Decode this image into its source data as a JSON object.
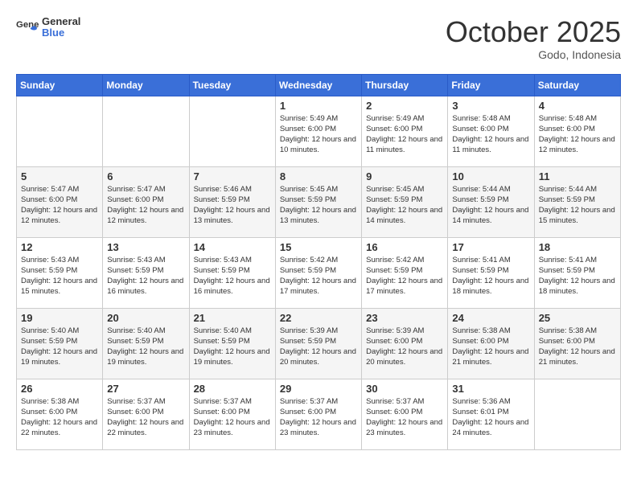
{
  "header": {
    "logo_general": "General",
    "logo_blue": "Blue",
    "month": "October 2025",
    "location": "Godo, Indonesia"
  },
  "weekdays": [
    "Sunday",
    "Monday",
    "Tuesday",
    "Wednesday",
    "Thursday",
    "Friday",
    "Saturday"
  ],
  "weeks": [
    [
      {
        "day": "",
        "text": ""
      },
      {
        "day": "",
        "text": ""
      },
      {
        "day": "",
        "text": ""
      },
      {
        "day": "1",
        "text": "Sunrise: 5:49 AM\nSunset: 6:00 PM\nDaylight: 12 hours and 10 minutes."
      },
      {
        "day": "2",
        "text": "Sunrise: 5:49 AM\nSunset: 6:00 PM\nDaylight: 12 hours and 11 minutes."
      },
      {
        "day": "3",
        "text": "Sunrise: 5:48 AM\nSunset: 6:00 PM\nDaylight: 12 hours and 11 minutes."
      },
      {
        "day": "4",
        "text": "Sunrise: 5:48 AM\nSunset: 6:00 PM\nDaylight: 12 hours and 12 minutes."
      }
    ],
    [
      {
        "day": "5",
        "text": "Sunrise: 5:47 AM\nSunset: 6:00 PM\nDaylight: 12 hours and 12 minutes."
      },
      {
        "day": "6",
        "text": "Sunrise: 5:47 AM\nSunset: 6:00 PM\nDaylight: 12 hours and 12 minutes."
      },
      {
        "day": "7",
        "text": "Sunrise: 5:46 AM\nSunset: 5:59 PM\nDaylight: 12 hours and 13 minutes."
      },
      {
        "day": "8",
        "text": "Sunrise: 5:45 AM\nSunset: 5:59 PM\nDaylight: 12 hours and 13 minutes."
      },
      {
        "day": "9",
        "text": "Sunrise: 5:45 AM\nSunset: 5:59 PM\nDaylight: 12 hours and 14 minutes."
      },
      {
        "day": "10",
        "text": "Sunrise: 5:44 AM\nSunset: 5:59 PM\nDaylight: 12 hours and 14 minutes."
      },
      {
        "day": "11",
        "text": "Sunrise: 5:44 AM\nSunset: 5:59 PM\nDaylight: 12 hours and 15 minutes."
      }
    ],
    [
      {
        "day": "12",
        "text": "Sunrise: 5:43 AM\nSunset: 5:59 PM\nDaylight: 12 hours and 15 minutes."
      },
      {
        "day": "13",
        "text": "Sunrise: 5:43 AM\nSunset: 5:59 PM\nDaylight: 12 hours and 16 minutes."
      },
      {
        "day": "14",
        "text": "Sunrise: 5:43 AM\nSunset: 5:59 PM\nDaylight: 12 hours and 16 minutes."
      },
      {
        "day": "15",
        "text": "Sunrise: 5:42 AM\nSunset: 5:59 PM\nDaylight: 12 hours and 17 minutes."
      },
      {
        "day": "16",
        "text": "Sunrise: 5:42 AM\nSunset: 5:59 PM\nDaylight: 12 hours and 17 minutes."
      },
      {
        "day": "17",
        "text": "Sunrise: 5:41 AM\nSunset: 5:59 PM\nDaylight: 12 hours and 18 minutes."
      },
      {
        "day": "18",
        "text": "Sunrise: 5:41 AM\nSunset: 5:59 PM\nDaylight: 12 hours and 18 minutes."
      }
    ],
    [
      {
        "day": "19",
        "text": "Sunrise: 5:40 AM\nSunset: 5:59 PM\nDaylight: 12 hours and 19 minutes."
      },
      {
        "day": "20",
        "text": "Sunrise: 5:40 AM\nSunset: 5:59 PM\nDaylight: 12 hours and 19 minutes."
      },
      {
        "day": "21",
        "text": "Sunrise: 5:40 AM\nSunset: 5:59 PM\nDaylight: 12 hours and 19 minutes."
      },
      {
        "day": "22",
        "text": "Sunrise: 5:39 AM\nSunset: 5:59 PM\nDaylight: 12 hours and 20 minutes."
      },
      {
        "day": "23",
        "text": "Sunrise: 5:39 AM\nSunset: 6:00 PM\nDaylight: 12 hours and 20 minutes."
      },
      {
        "day": "24",
        "text": "Sunrise: 5:38 AM\nSunset: 6:00 PM\nDaylight: 12 hours and 21 minutes."
      },
      {
        "day": "25",
        "text": "Sunrise: 5:38 AM\nSunset: 6:00 PM\nDaylight: 12 hours and 21 minutes."
      }
    ],
    [
      {
        "day": "26",
        "text": "Sunrise: 5:38 AM\nSunset: 6:00 PM\nDaylight: 12 hours and 22 minutes."
      },
      {
        "day": "27",
        "text": "Sunrise: 5:37 AM\nSunset: 6:00 PM\nDaylight: 12 hours and 22 minutes."
      },
      {
        "day": "28",
        "text": "Sunrise: 5:37 AM\nSunset: 6:00 PM\nDaylight: 12 hours and 23 minutes."
      },
      {
        "day": "29",
        "text": "Sunrise: 5:37 AM\nSunset: 6:00 PM\nDaylight: 12 hours and 23 minutes."
      },
      {
        "day": "30",
        "text": "Sunrise: 5:37 AM\nSunset: 6:00 PM\nDaylight: 12 hours and 23 minutes."
      },
      {
        "day": "31",
        "text": "Sunrise: 5:36 AM\nSunset: 6:01 PM\nDaylight: 12 hours and 24 minutes."
      },
      {
        "day": "",
        "text": ""
      }
    ]
  ]
}
